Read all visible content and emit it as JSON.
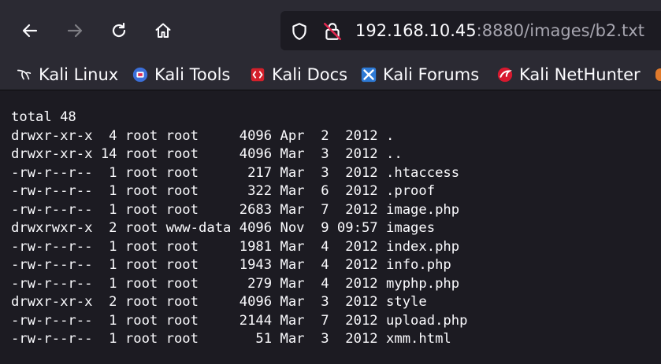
{
  "browser": {
    "url": {
      "host": "192.168.10.45",
      "rest": ":8880/images/b2.txt"
    },
    "icons": {
      "back": "back-arrow-icon",
      "forward": "forward-arrow-icon",
      "reload": "reload-icon",
      "home": "home-icon",
      "shield": "shield-icon",
      "insecure_lock": "insecure-lock-icon"
    }
  },
  "bookmarks": [
    {
      "label": "Kali Linux",
      "icon": "kali-dragon-icon"
    },
    {
      "label": "Kali Tools",
      "icon": "kali-tools-icon"
    },
    {
      "label": "Kali Docs",
      "icon": "kali-docs-icon"
    },
    {
      "label": "Kali Forums",
      "icon": "kali-forums-icon"
    },
    {
      "label": "Kali NetHunter",
      "icon": "kali-nethunter-icon"
    }
  ],
  "listing": {
    "lines": [
      "total 48",
      "drwxr-xr-x  4 root root     4096 Apr  2  2012 .",
      "drwxr-xr-x 14 root root     4096 Mar  3  2012 ..",
      "-rw-r--r--  1 root root      217 Mar  3  2012 .htaccess",
      "-rw-r--r--  1 root root      322 Mar  6  2012 .proof",
      "-rw-r--r--  1 root root     2683 Mar  7  2012 image.php",
      "drwxrwxr-x  2 root www-data 4096 Nov  9 09:57 images",
      "-rw-r--r--  1 root root     1981 Mar  4  2012 index.php",
      "-rw-r--r--  1 root root     1943 Mar  4  2012 info.php",
      "-rw-r--r--  1 root root      279 Mar  4  2012 myphp.php",
      "drwxr-xr-x  2 root root     4096 Mar  3  2012 style",
      "-rw-r--r--  1 root root     2144 Mar  7  2012 upload.php",
      "-rw-r--r--  1 root root       51 Mar  3  2012 xmm.html"
    ]
  },
  "colors": {
    "toolbar": "#2b2a33",
    "page": "#1c1b22",
    "text": "#fbfbfe",
    "url_dim": "#a7a6b0"
  }
}
